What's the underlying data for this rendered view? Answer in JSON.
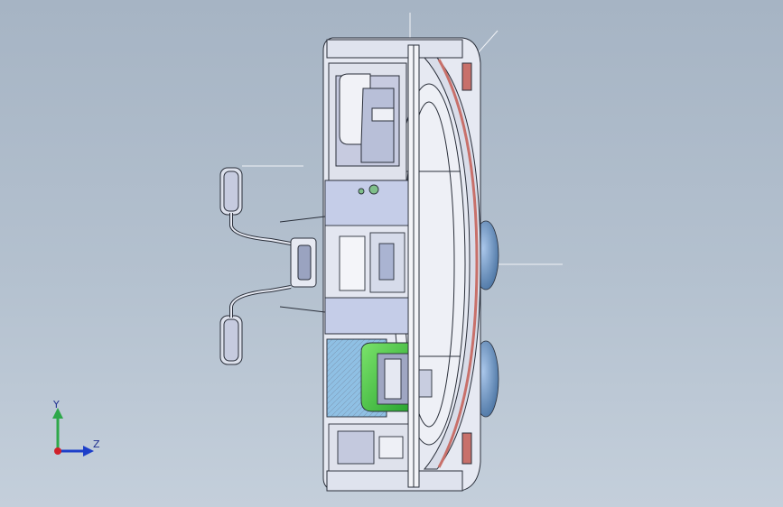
{
  "viewport": {
    "background_top": "#a6b4c4",
    "background_bottom": "#c4cfdb"
  },
  "triad": {
    "y_label": "Y",
    "z_label": "Z",
    "y_color": "#2ea84a",
    "z_color": "#1d3fc9",
    "origin_color": "#d0202a"
  },
  "colors": {
    "part_fill": "#e9ecf4",
    "edge": "#2a2f3a",
    "accent_blue": "#7f9fd6",
    "accent_green": "#3fc43f",
    "accent_red": "#c8706a",
    "light_blue_panel": "#8fc0e4",
    "sphere_blue": "#5e8fc8"
  }
}
